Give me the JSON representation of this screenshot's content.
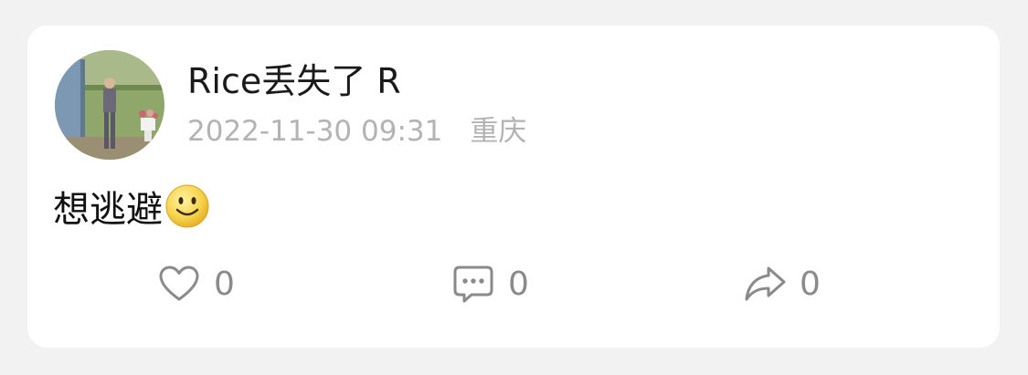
{
  "post": {
    "author": "Rice丢失了 R",
    "datetime": "2022-11-30 09:31",
    "location": "重庆",
    "text": "想逃避",
    "emoji_icon": "slightly-smiling-face-icon"
  },
  "actions": {
    "like": {
      "icon": "heart-outline-icon",
      "count": "0"
    },
    "comment": {
      "icon": "comment-bubble-icon",
      "count": "0"
    },
    "share": {
      "icon": "share-arrow-icon",
      "count": "0"
    }
  },
  "colors": {
    "background": "#f2f2f2",
    "card": "#ffffff",
    "author_text": "#1a1a1a",
    "meta_text": "#b3b3b3",
    "icon_gray": "#8a8a8a"
  }
}
